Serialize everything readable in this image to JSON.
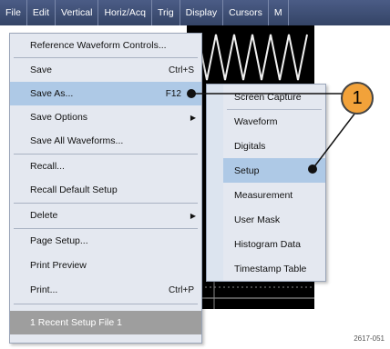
{
  "menubar": {
    "items": [
      "File",
      "Edit",
      "Vertical",
      "Horiz/Acq",
      "Trig",
      "Display",
      "Cursors",
      "M"
    ]
  },
  "file_menu": {
    "items": [
      {
        "label": "Reference Waveform Controls...",
        "shortcut": "",
        "submenu": false
      },
      {
        "label": "Save",
        "shortcut": "Ctrl+S",
        "submenu": false
      },
      {
        "label": "Save As...",
        "shortcut": "F12",
        "submenu": false
      },
      {
        "label": "Save Options",
        "shortcut": "",
        "submenu": true
      },
      {
        "label": "Save All Waveforms...",
        "shortcut": "",
        "submenu": false
      },
      {
        "label": "Recall...",
        "shortcut": "",
        "submenu": false
      },
      {
        "label": "Recall Default Setup",
        "shortcut": "",
        "submenu": false
      },
      {
        "label": "Delete",
        "shortcut": "",
        "submenu": true
      },
      {
        "label": "Page Setup...",
        "shortcut": "",
        "submenu": false
      },
      {
        "label": "Print Preview",
        "shortcut": "",
        "submenu": false
      },
      {
        "label": "Print...",
        "shortcut": "Ctrl+P",
        "submenu": false
      },
      {
        "label": "1 Recent Setup File 1",
        "shortcut": "",
        "submenu": false
      }
    ],
    "selected": "Save As..."
  },
  "save_as_submenu": {
    "items": [
      "Screen Capture",
      "Waveform",
      "Digitals",
      "Setup",
      "Measurement",
      "User Mask",
      "Histogram Data",
      "Timestamp Table"
    ],
    "selected": "Setup"
  },
  "callout": {
    "label": "1",
    "color": "#f2a23a"
  },
  "figure_id": "2617-051",
  "colors": {
    "menubar": "#3d4d74",
    "highlight": "#aec9e6",
    "menu_bg": "#e4e8f0",
    "waveform": "#f0f0f0"
  }
}
